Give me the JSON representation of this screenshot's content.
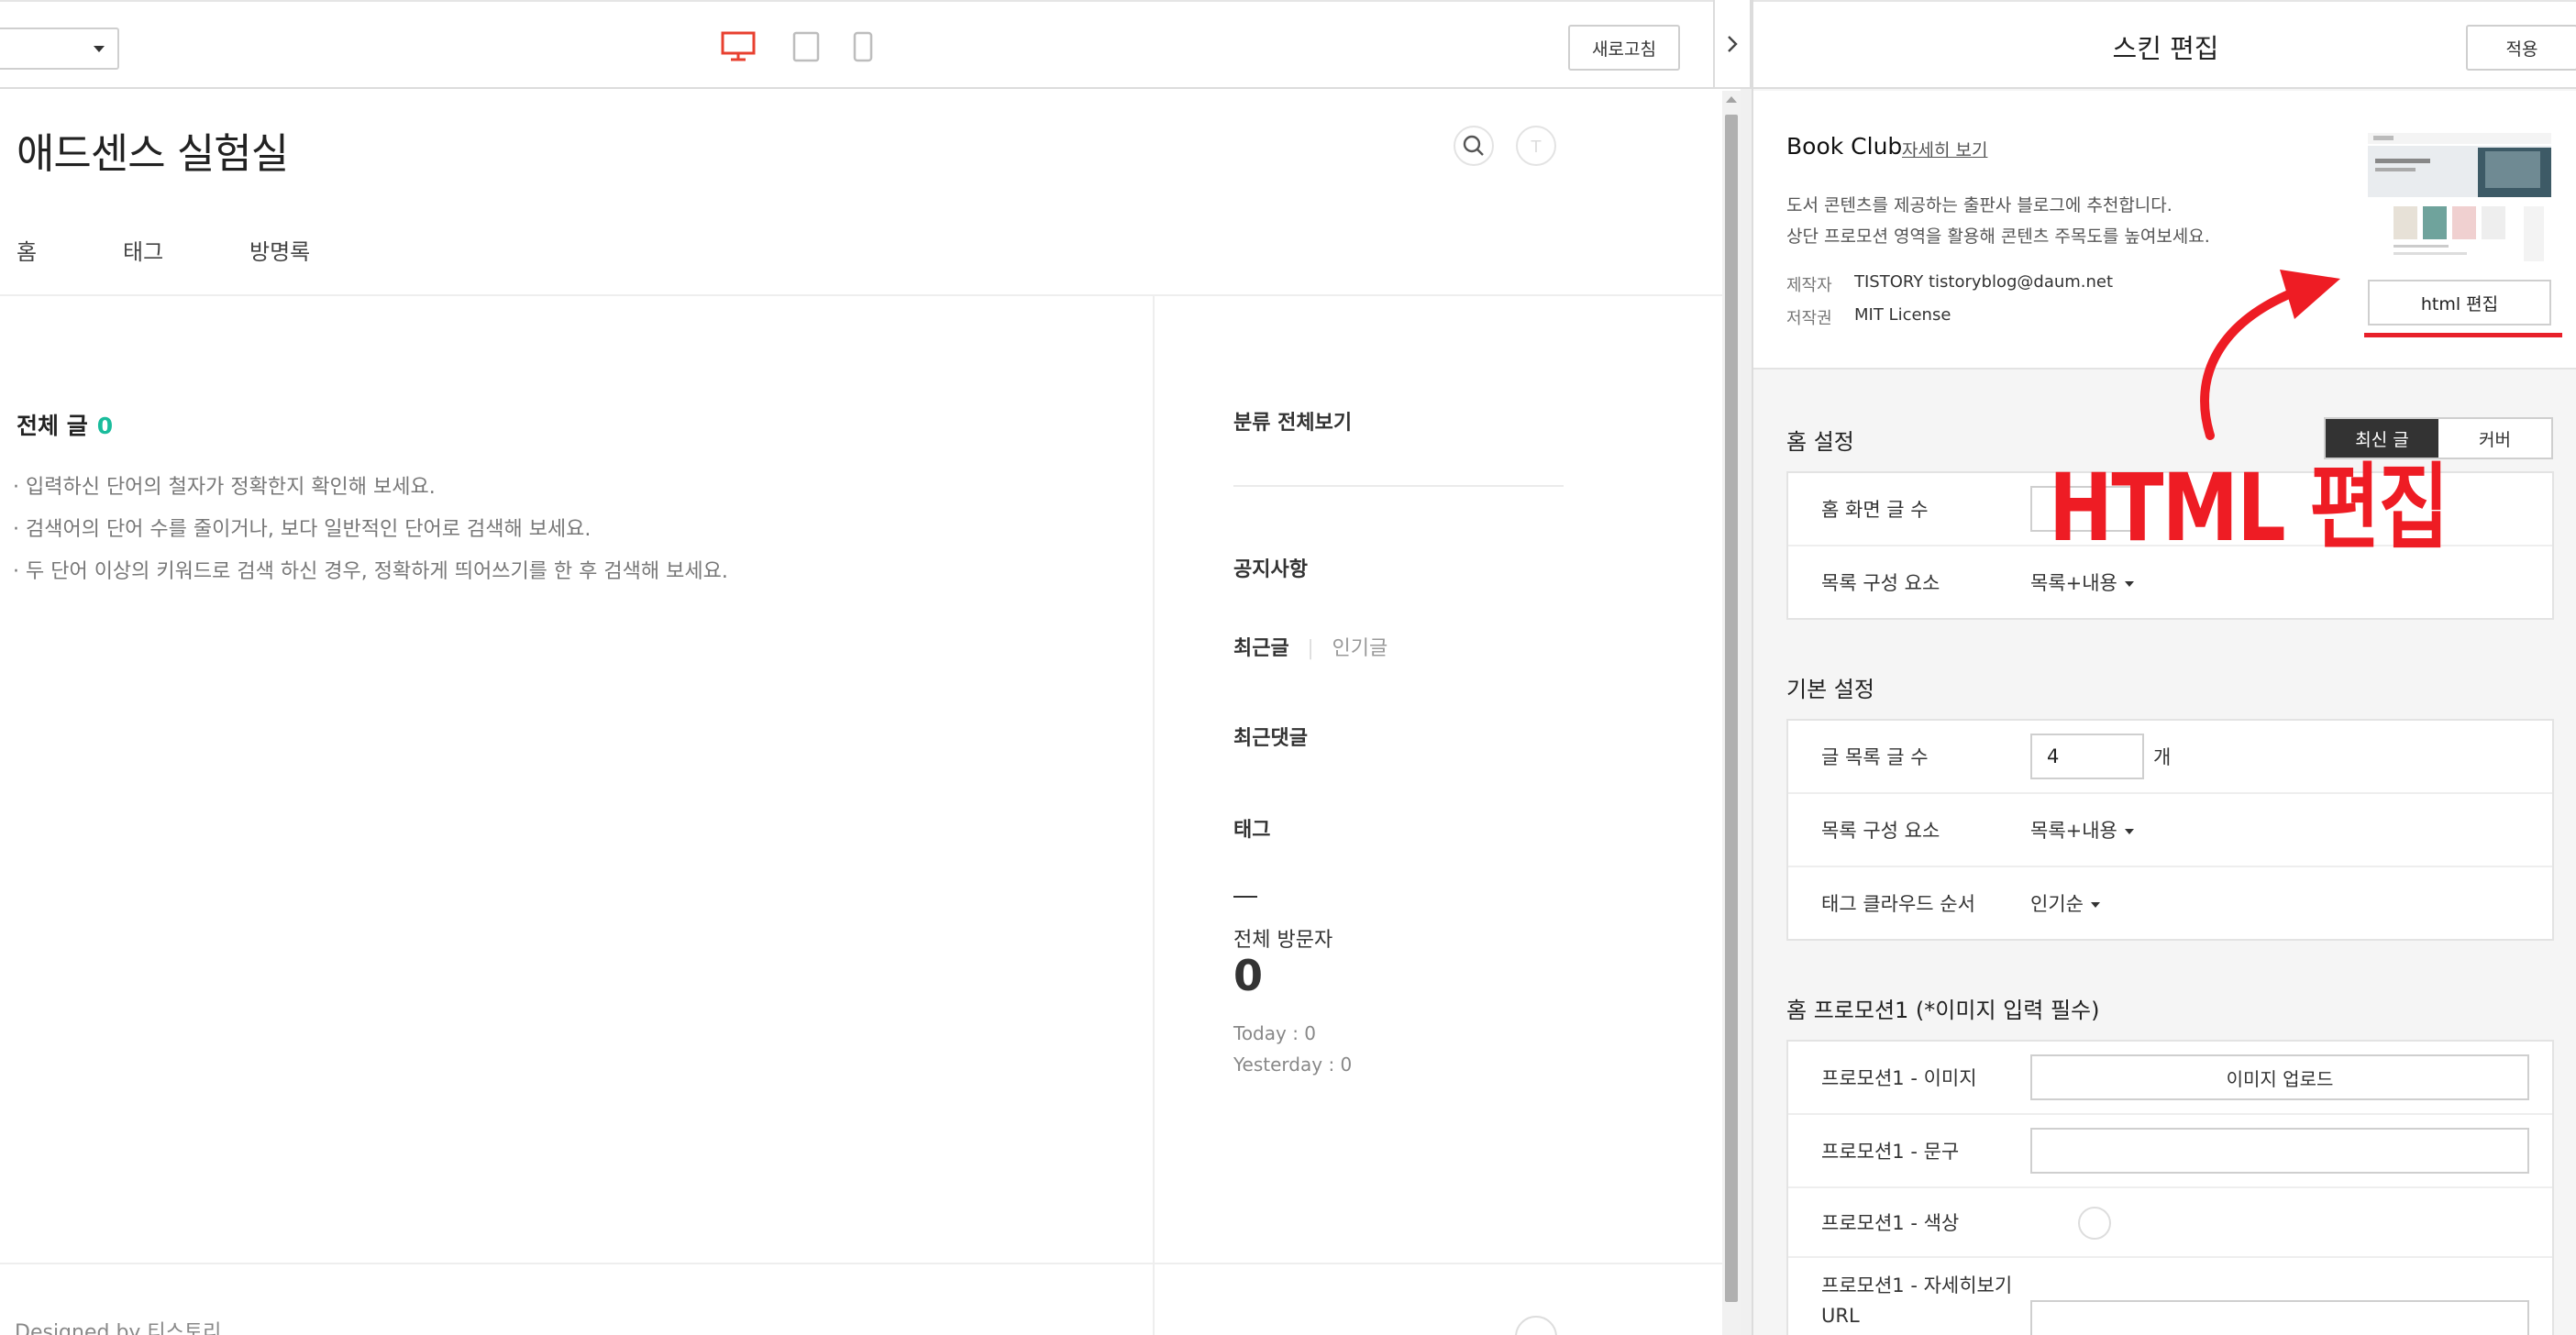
{
  "toolbar": {
    "refresh_label": "새로고침",
    "device_icons": [
      "desktop-icon",
      "tablet-icon",
      "mobile-icon"
    ],
    "active_device_color": "#e8402f"
  },
  "blog": {
    "title": "애드센스 실험실",
    "nav": [
      "홈",
      "태그",
      "방명록"
    ],
    "all_posts_label": "전체 글",
    "all_posts_count": "0",
    "tips": [
      "· 입력하신 단어의 철자가 정확한지 확인해 보세요.",
      "· 검색어의 단어 수를 줄이거나, 보다 일반적인 단어로 검색해 보세요.",
      "· 두 단어 이상의 키워드로 검색 하신 경우, 정확하게 띄어쓰기를 한 후 검색해 보세요."
    ],
    "sidebar": {
      "category_all": "분류 전체보기",
      "notice": "공지사항",
      "recent": "최근글",
      "popular": "인기글",
      "recent_comments": "최근댓글",
      "tag": "태그",
      "visitors_label": "전체 방문자",
      "visitors_count": "0",
      "today": "Today : 0",
      "yesterday": "Yesterday : 0"
    },
    "footer": "Designed by 티스토리"
  },
  "panel": {
    "title": "스킨 편집",
    "apply_label": "적용",
    "skin": {
      "name": "Book Club",
      "more_link": "자세히 보기",
      "desc1": "도서 콘텐츠를 제공하는 출판사 블로그에 추천합니다.",
      "desc2": "상단 프로모션 영역을 활용해 콘텐츠 주목도를 높여보세요.",
      "maker_label": "제작자",
      "maker_value": "TISTORY tistoryblog@daum.net",
      "license_label": "저작권",
      "license_value": "MIT License",
      "html_edit_label": "html 편집"
    },
    "home_settings": {
      "title": "홈 설정",
      "toggle": [
        "최신 글",
        "커버"
      ],
      "rows": [
        {
          "label": "홈 화면 글 수",
          "value": ""
        },
        {
          "label": "목록 구성 요소",
          "value": "목록+내용"
        }
      ]
    },
    "basic_settings": {
      "title": "기본 설정",
      "post_count_label": "글 목록 글 수",
      "post_count_value": "4",
      "post_count_unit": "개",
      "list_component_label": "목록 구성 요소",
      "list_component_value": "목록+내용",
      "tag_cloud_label": "태그 클라우드 순서",
      "tag_cloud_value": "인기순"
    },
    "promotion": {
      "title": "홈 프로모션1 (*이미지 입력 필수)",
      "image_label": "프로모션1 - 이미지",
      "upload_label": "이미지 업로드",
      "text_label": "프로모션1 - 문구",
      "color_label": "프로모션1 - 색상",
      "url_label_1": "프로모션1 - 자세히보기",
      "url_label_2": "URL"
    }
  },
  "annotation": {
    "text": "HTML 편집",
    "color": "#ee1c24"
  }
}
